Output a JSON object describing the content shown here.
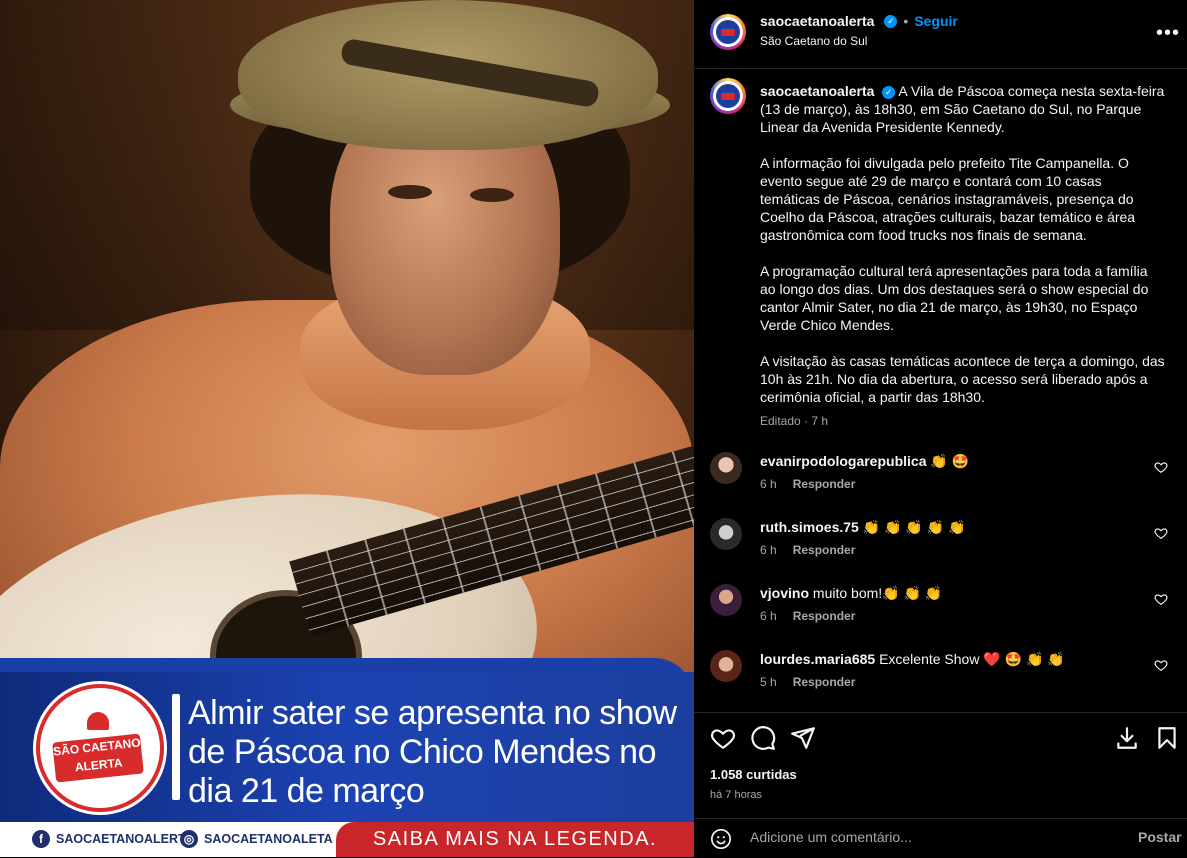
{
  "post": {
    "media": {
      "headline": "Almir sater se apresenta no show de Páscoa no Chico Mendes no dia 21 de março",
      "logo_line1": "SÃO CAETANO",
      "logo_line2": "ALERTA",
      "social_fb": "SAOCAETANOALERTA",
      "social_ig": "SAOCAETANOALETA",
      "cta": "SAIBA MAIS NA LEGENDA."
    },
    "header": {
      "username": "saocaetanoalerta",
      "separator": "•",
      "follow_label": "Seguir",
      "location": "São Caetano do Sul",
      "more_label": "•••"
    },
    "caption": {
      "username": "saocaetanoalerta",
      "paragraph1": "A Vila de Páscoa começa nesta sexta-feira (13 de março), às 18h30, em São Caetano do Sul, no Parque Linear da Avenida Presidente Kennedy.",
      "paragraph2": "A informação foi divulgada pelo prefeito Tite Campanella. O evento segue até 29 de março e contará com 10 casas temáticas de Páscoa, cenários instagramáveis, presença do Coelho da Páscoa, atrações culturais, bazar temático e área gastronômica com food trucks nos finais de semana.",
      "paragraph3": "A programação cultural terá apresentações para toda a família ao longo dos dias. Um dos destaques será o show especial do cantor Almir Sater, no dia 21 de março, às 19h30, no Espaço Verde Chico Mendes.",
      "paragraph4": "A visitação às casas temáticas acontece de terça a domingo, das 10h às 21h. No dia da abertura, o acesso será liberado após a cerimônia oficial, a partir das 18h30.",
      "meta": "Editado · 7 h"
    },
    "comments": [
      {
        "username": "evanirpodologarepublica",
        "text": "👏 🤩",
        "time": "6 h",
        "reply": "Responder"
      },
      {
        "username": "ruth.simoes.75",
        "text": "👏 👏 👏 👏 👏",
        "time": "6 h",
        "reply": "Responder"
      },
      {
        "username": "vjovino",
        "text": "muito bom!👏 👏 👏",
        "time": "6 h",
        "reply": "Responder"
      },
      {
        "username": "lourdes.maria685",
        "text": "Excelente Show ❤️ 🤩 👏 👏",
        "time": "5 h",
        "reply": "Responder"
      }
    ],
    "actions": {
      "likes": "1.058 curtidas",
      "ago": "há 7 horas"
    },
    "add_comment": {
      "placeholder": "Adicione um comentário...",
      "post_label": "Postar"
    }
  }
}
